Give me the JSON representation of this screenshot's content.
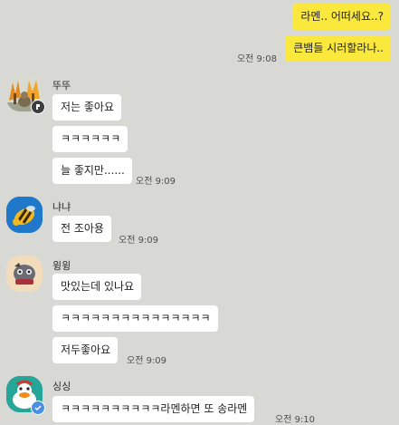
{
  "chat": {
    "my_messages": [
      {
        "text": "라멘.. 어떠세요..?"
      },
      {
        "text": "큰뱀들 시러할라나..",
        "time": "오전 9:08"
      }
    ],
    "groups": [
      {
        "sender": "뚜뚜",
        "avatar": "autumn-tree-avatar",
        "messages": [
          "저는 좋아요",
          "ㅋㅋㅋㅋㅋㅋ",
          "늘 좋지만......"
        ],
        "time": "오전 9:09"
      },
      {
        "sender": "냐냐",
        "avatar": "bee-avatar",
        "messages": [
          "전 조아용"
        ],
        "time": "오전 9:09"
      },
      {
        "sender": "윙윙",
        "avatar": "cartoon-creature-avatar",
        "messages": [
          "맛있는데 있나요",
          "ㅋㅋㅋㅋㅋㅋㅋㅋㅋㅋㅋㅋㅋㅋㅋ",
          "저두좋아요"
        ],
        "time": "오전 9:09"
      },
      {
        "sender": "싱싱",
        "avatar": "duck-avatar",
        "messages": [
          "ㅋㅋㅋㅋㅋㅋㅋㅋㅋㅋ라멘하면 또 송라멘"
        ],
        "time": "오전 9:10"
      }
    ]
  },
  "colors": {
    "background": "#d8d8d4",
    "my_bubble": "#fbe83d",
    "their_bubble": "#ffffff",
    "manager_badge": "#3d3d3d",
    "verified_badge": "#4a90e2"
  }
}
